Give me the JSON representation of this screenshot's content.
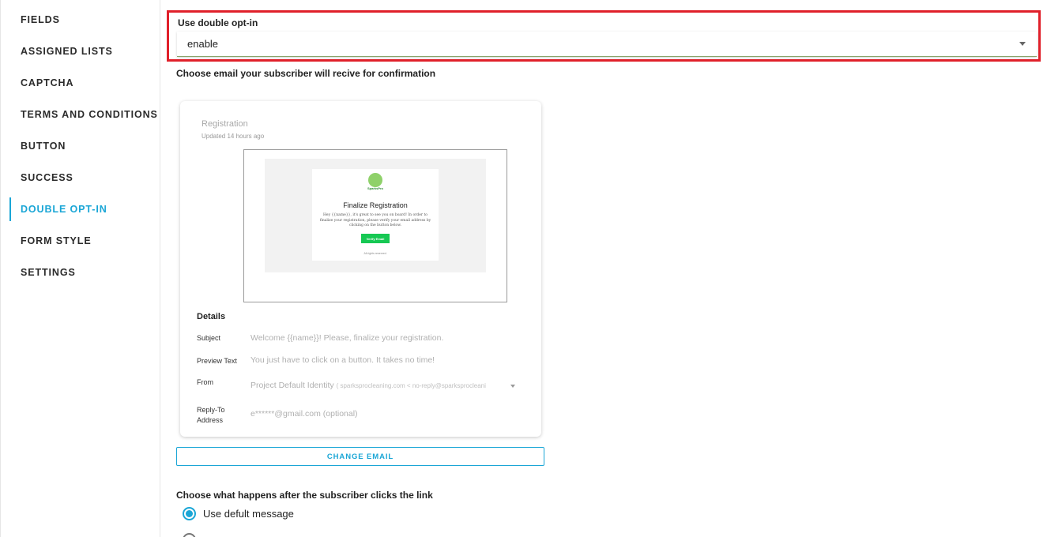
{
  "sidebar": {
    "items": [
      {
        "label": "FIELDS"
      },
      {
        "label": "ASSIGNED LISTS"
      },
      {
        "label": "CAPTCHA"
      },
      {
        "label": "TERMS AND CONDITIONS"
      },
      {
        "label": "BUTTON"
      },
      {
        "label": "SUCCESS"
      },
      {
        "label": "DOUBLE OPT-IN",
        "active": true
      },
      {
        "label": "FORM STYLE"
      },
      {
        "label": "SETTINGS"
      }
    ]
  },
  "double_opt_in": {
    "label": "Use double opt-in",
    "value": "enable"
  },
  "email_section": {
    "heading": "Choose email your subscriber will recive for confirmation",
    "card": {
      "title": "Registration",
      "updated": "Updated 14 hours ago",
      "preview": {
        "logo_text": "SparksPro",
        "heading": "Finalize Registration",
        "body": "Hey {{name}}, it's great to see you on board! In order to finalize your registration, please verify your email address by clicking on the button below.",
        "button": "Verify Email",
        "footer": "All rights reserved."
      },
      "details": {
        "heading": "Details",
        "subject_label": "Subject",
        "subject_value": "Welcome {{name}}! Please, finalize your registration.",
        "preview_label": "Preview Text",
        "preview_value": "You just have to click on a button. It takes no time!",
        "from_label": "From",
        "from_value": "Project Default Identity",
        "from_sub": "( sparksprocleaning.com < no-reply@sparksprocleani",
        "reply_label": "Reply-To Address",
        "reply_value": "e******@gmail.com (optional)"
      }
    },
    "change_button": "CHANGE EMAIL"
  },
  "after_click": {
    "heading": "Choose what happens after the subscriber clicks the link",
    "option_selected": "Use defult message"
  },
  "colors": {
    "accent": "#1aa6d6",
    "highlight_border": "#e0202a",
    "verify_button": "#16c853"
  }
}
